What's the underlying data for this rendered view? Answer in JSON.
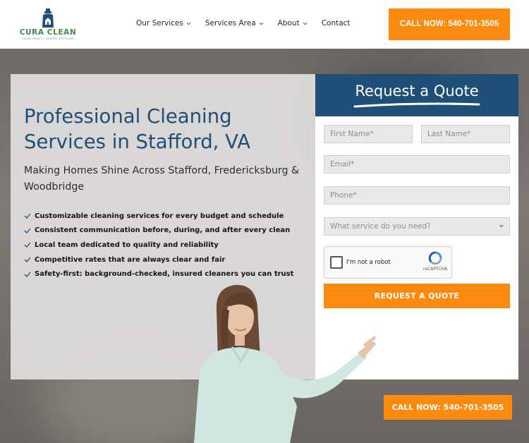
{
  "header": {
    "logo": {
      "name": "CURA CLEAN",
      "tagline": "CLEAN SPACES, CURATED WITH CARE"
    },
    "nav": [
      {
        "label": "Our Services",
        "has_dropdown": true
      },
      {
        "label": "Services Area",
        "has_dropdown": true
      },
      {
        "label": "About",
        "has_dropdown": true
      },
      {
        "label": "Contact",
        "has_dropdown": false
      }
    ],
    "call_button": "CALL NOW: 540-701-3505"
  },
  "hero": {
    "headline": "Professional Cleaning Services in Stafford, VA",
    "subhead": "Making Homes Shine Across Stafford, Fredericksburg & Woodbridge",
    "benefits": [
      "Customizable cleaning services for every budget and schedule",
      "Consistent communication before, during, and after every clean",
      "Local team dedicated to quality and reliability",
      "Competitive rates that are always clear and fair",
      "Safety-first: background-checked, insured cleaners you can trust"
    ]
  },
  "quote_form": {
    "title": "Request a Quote",
    "first_name_placeholder": "First Name*",
    "last_name_placeholder": "Last Name*",
    "email_placeholder": "Email*",
    "phone_placeholder": "Phone*",
    "service_select": "What service do you need?",
    "captcha": {
      "label": "I'm not a robot",
      "brand": "reCAPTCHA"
    },
    "submit_label": "REQUEST A QUOTE"
  },
  "floating_call_button": "CALL NOW: 540-701-3505",
  "colors": {
    "accent": "#fb8a0e",
    "brand_blue": "#1f4e79",
    "logo_green": "#3f8a4a"
  }
}
